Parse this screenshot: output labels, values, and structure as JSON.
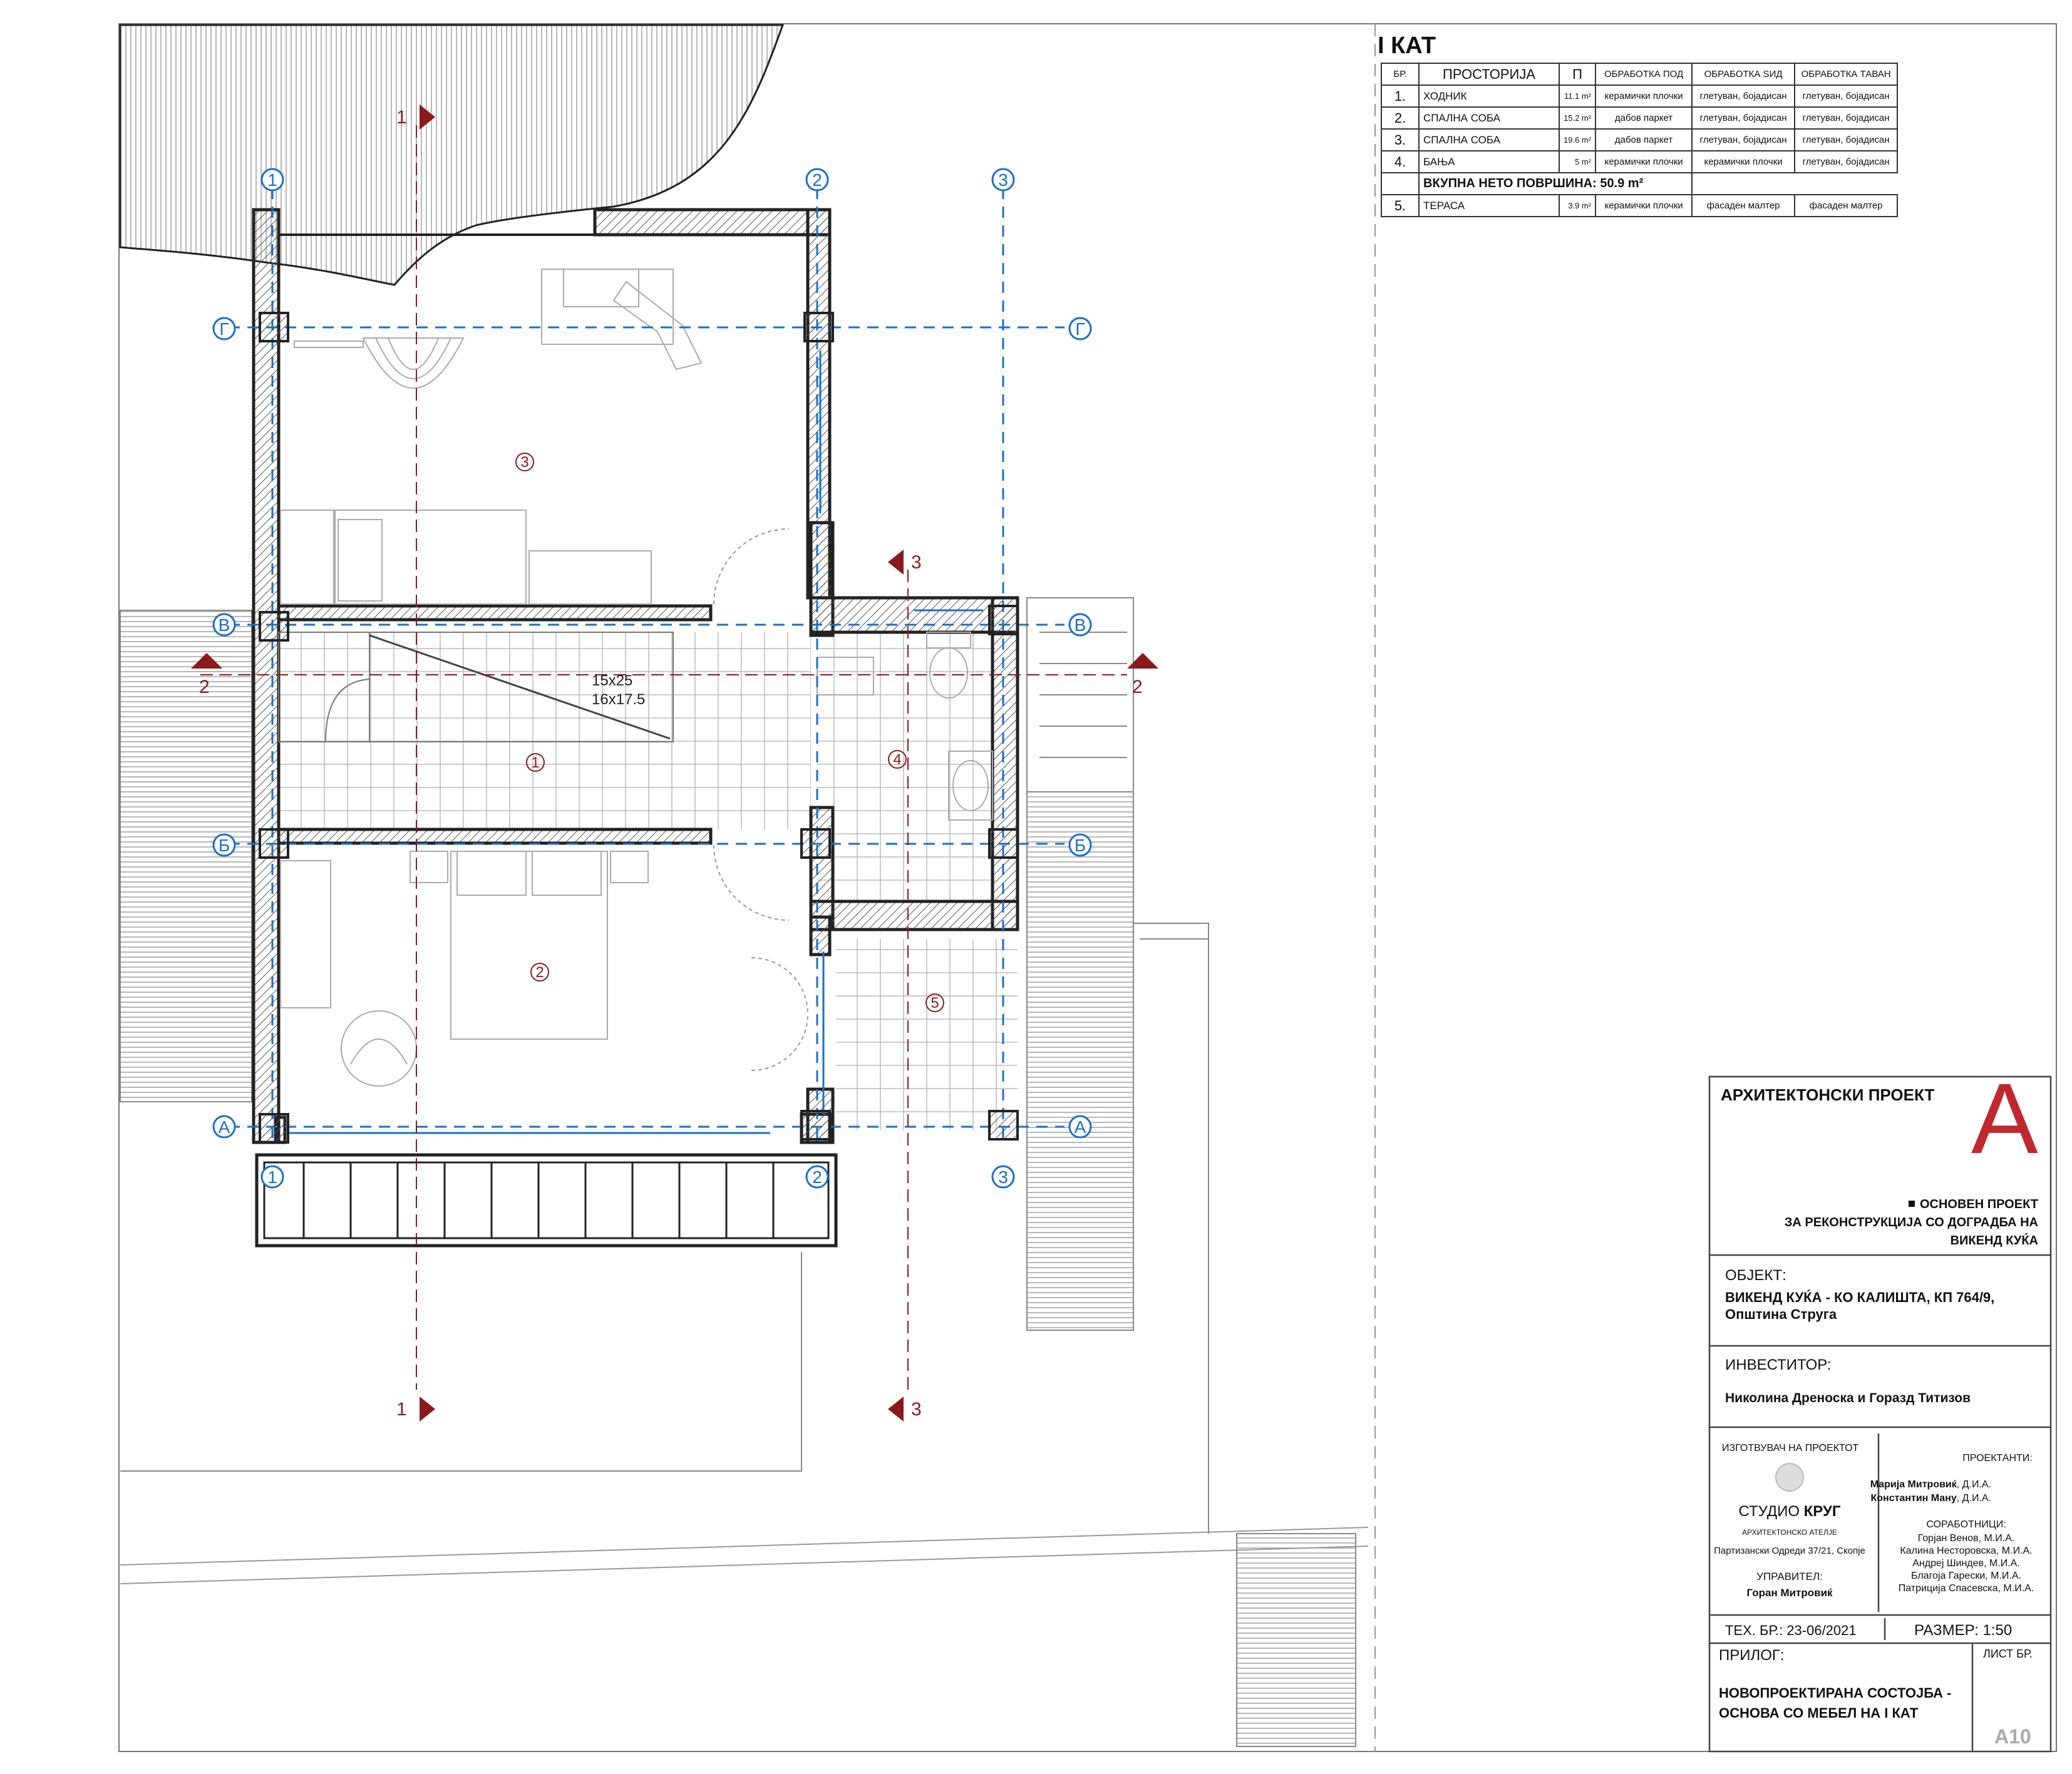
{
  "plan": {
    "grid_labels_vertical": [
      "1",
      "2",
      "3"
    ],
    "grid_labels_horizontal": [
      "Г",
      "В",
      "Б",
      "А"
    ],
    "rooms": [
      {
        "num": "1"
      },
      {
        "num": "2"
      },
      {
        "num": "3"
      },
      {
        "num": "4"
      },
      {
        "num": "5"
      }
    ],
    "section_marks": [
      "1",
      "1",
      "2",
      "2",
      "3",
      "3"
    ],
    "stair_note_1": "15x25",
    "stair_note_2": "16x17.5"
  },
  "room_table": {
    "title": "I КАТ",
    "headers": [
      "БР.",
      "ПРОСТОРИЈА",
      "П",
      "ОБРАБОТКА ПОД",
      "ОБРАБОТКА ЅИД",
      "ОБРАБОТКА ТАВАН"
    ],
    "rows": [
      {
        "no": "1.",
        "name": "ХОДНИК",
        "area": "11.1 m²",
        "floor": "керамички плочки",
        "wall": "глетуван, бојадисан",
        "ceiling": "глетуван, бојадисан"
      },
      {
        "no": "2.",
        "name": "СПАЛНА СОБА",
        "area": "15.2 m²",
        "floor": "дабов паркет",
        "wall": "глетуван, бојадисан",
        "ceiling": "глетуван, бојадисан"
      },
      {
        "no": "3.",
        "name": "СПАЛНА СОБА",
        "area": "19.6 m²",
        "floor": "дабов паркет",
        "wall": "глетуван, бојадисан",
        "ceiling": "глетуван, бојадисан"
      },
      {
        "no": "4.",
        "name": "БАЊА",
        "area": "5 m²",
        "floor": "керамички плочки",
        "wall": "керамички плочки",
        "ceiling": "глетуван, бојадисан"
      }
    ],
    "total": "ВКУПНА НЕТО ПОВРШИНА:  50.9 m²",
    "extra_row": {
      "no": "5.",
      "name": "ТЕРАСА",
      "area": "3.9 m²",
      "floor": "керамички плочки",
      "wall": "фасаден малтер",
      "ceiling": "фасаден малтер"
    }
  },
  "title_block": {
    "project_type": "АРХИТЕКТОНСКИ ПРОЕКТ",
    "big_letter": "A",
    "project_kind_1": "ОСНОВЕН ПРОЕКТ",
    "project_kind_2": "ЗА РЕКОНСТРУКЦИЈА СО ДОГРАДБА НА",
    "project_kind_3": "ВИКЕНД КУЌА",
    "object_label": "ОБЈЕКТ:",
    "object_1": "ВИКЕНД КУЌА - КО КАЛИШТА, КП 764/9,",
    "object_2": "Општина Струга",
    "investor_label": "ИНВЕСТИТОР:",
    "investor": "Николина Дреноска и Горазд Титизов",
    "maker_label": "ИЗГОТВУВАЧ НА ПРОЕКТОТ",
    "studio_a": "СТУДИО ",
    "studio_b": "КРУГ",
    "studio_sub": "АРХИТЕКТОНСКО АТЕЛЈЕ",
    "studio_addr": "Партизански Одреди 37/21, Скопје",
    "manager_label": "УПРАВИТЕЛ:",
    "manager": "Горан Митровиќ",
    "designers_label": "ПРОЕКТАНТИ:",
    "designer_1_name": "Марија Митровиќ",
    "designer_1_title": ", Д.И.А.",
    "designer_2_name": "Константин Ману",
    "designer_2_title": ", Д.И.А.",
    "collab_label": "СОРАБОТНИЦИ:",
    "collab": [
      "Горјан Венов, М.И.А.",
      "Калина Несторовска, М.И.А.",
      "Андреј Шиндев, М.И.А.",
      "Благоја Гарески, М.И.А.",
      "Патриција Спасевска, М.И.А."
    ],
    "tech_no": "ТЕХ. БР.: 23-06/2021",
    "scale": "РАЗМЕР:  1:50",
    "appendix_label": "ПРИЛОГ:",
    "sheet_label": "ЛИСТ БР.",
    "appendix_1": "НОВОПРОЕКТИРАНА СОСТОЈБА -",
    "appendix_2": "ОСНОВА СО МЕБЕЛ НА I КАТ",
    "sheet_no": "A10"
  },
  "colors": {
    "grid": "#1a6fc9",
    "section": "#8b1a1a",
    "wall": "#222222",
    "big_letter": "#c0282d"
  }
}
